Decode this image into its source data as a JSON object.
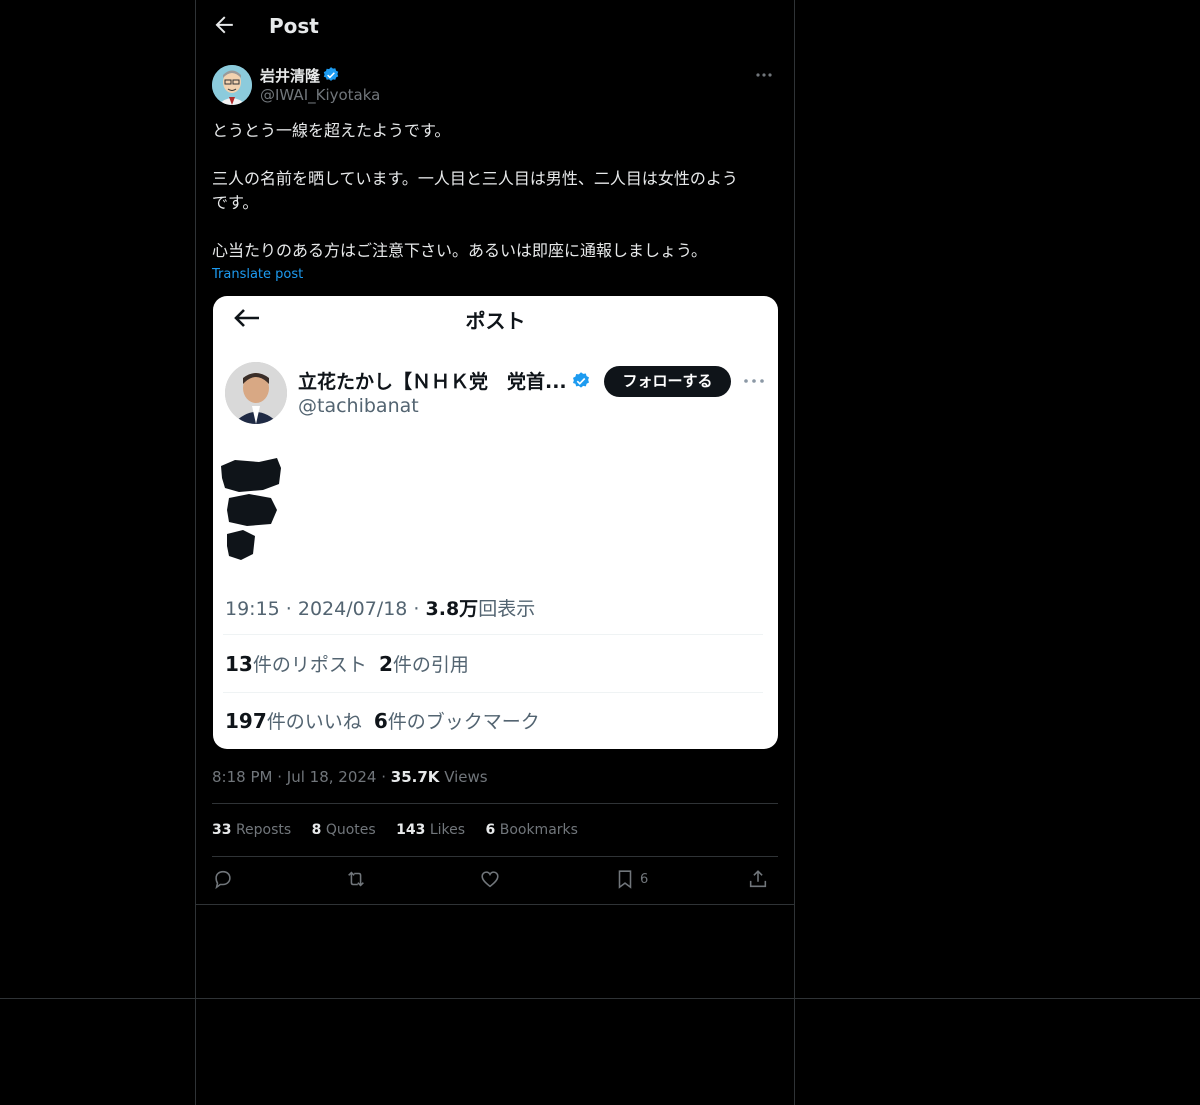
{
  "header": {
    "title": "Post"
  },
  "author": {
    "name": "岩井清隆",
    "handle": "@IWAI_Kiyotaka"
  },
  "post": {
    "lines": [
      "とうとう一線を超えたようです。",
      "",
      "三人の名前を晒しています。一人目と三人目は男性、二人目は女性のよう",
      "です。",
      "",
      "心当たりのある方はご注意下さい。あるいは即座に通報しましょう。"
    ],
    "translate_label": "Translate post"
  },
  "media": {
    "title": "ポスト",
    "name": "立花たかし【ＮＨＫ党　党首...",
    "handle": "@tachibanat",
    "follow_label": "フォローする",
    "meta_time": "19:15 · 2024/07/18 · ",
    "meta_views_count": "3.8万",
    "meta_views_label": "回表示",
    "reposts_count": "13",
    "reposts_label": "件のリポスト",
    "quotes_count": "2",
    "quotes_label": "件の引用",
    "likes_count": "197",
    "likes_label": "件のいいね",
    "bookmarks_count": "6",
    "bookmarks_label": "件のブックマーク"
  },
  "timestamp": {
    "time": "8:18 PM",
    "date": "Jul 18, 2024",
    "views_count": "35.7K",
    "views_label": "Views"
  },
  "stats": {
    "reposts_count": "33",
    "reposts_label": "Reposts",
    "quotes_count": "8",
    "quotes_label": "Quotes",
    "likes_count": "143",
    "likes_label": "Likes",
    "bookmarks_count": "6",
    "bookmarks_label": "Bookmarks"
  },
  "actions": {
    "bookmark_count": "6"
  },
  "colors": {
    "accent": "#1d9bf0",
    "muted": "#71767b",
    "border": "#2f3336"
  }
}
